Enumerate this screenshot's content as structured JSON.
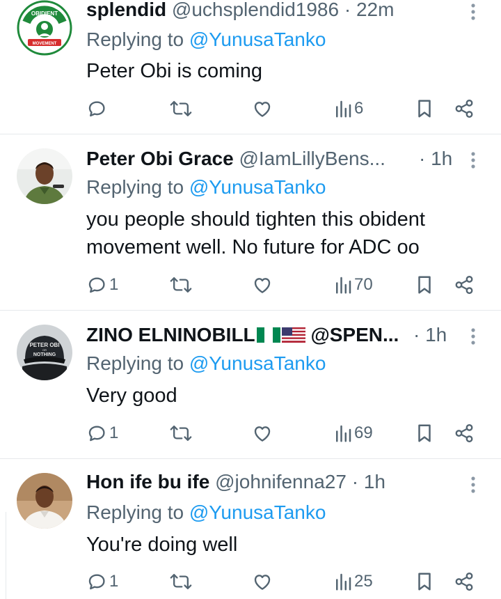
{
  "colors": {
    "text": "#0f1419",
    "muted": "#536471",
    "link": "#1d9bf0",
    "divider": "#e6e9ec"
  },
  "replies": [
    {
      "name": "splendid",
      "handle": "@uchsplendid1986",
      "time": "· 22m",
      "replying_prefix": "Replying to ",
      "replying_to": "@YunusaTanko",
      "text": "Peter Obi is coming",
      "avatar": "obidient-movement-logo",
      "avatar_lettering": "OBIDIENT MOVEMENT",
      "reply_count": "",
      "views": "6"
    },
    {
      "name": "Peter Obi Grace",
      "handle": "@IamLillyBens...",
      "time": "· 1h",
      "replying_prefix": "Replying to ",
      "replying_to": "@YunusaTanko",
      "text": "you people should tighten this obident movement well. No future for ADC oo",
      "avatar": "man-green-shirt-photo",
      "reply_count": "1",
      "views": "70"
    },
    {
      "name": "ZINO ELNINOBILL",
      "name_flags": [
        "nigeria-flag",
        "us-flag"
      ],
      "handle": "@SPEN...",
      "time": "· 1h",
      "replying_prefix": "Replying to ",
      "replying_to": "@YunusaTanko",
      "text": "Very good",
      "avatar": "peter-obi-cap-photo",
      "avatar_lettering": "PETER OBI OR NOTHING",
      "reply_count": "1",
      "views": "69"
    },
    {
      "name": "Hon ife bu ife",
      "handle": "@johnifenna27",
      "time": "· 1h",
      "replying_prefix": "Replying to ",
      "replying_to": "@YunusaTanko",
      "text": "You're doing well",
      "avatar": "man-white-shirt-photo",
      "reply_count": "1",
      "views": "25"
    }
  ],
  "icons": [
    "reply-icon",
    "retweet-icon",
    "like-icon",
    "views-icon",
    "bookmark-icon",
    "share-icon",
    "more-icon"
  ]
}
